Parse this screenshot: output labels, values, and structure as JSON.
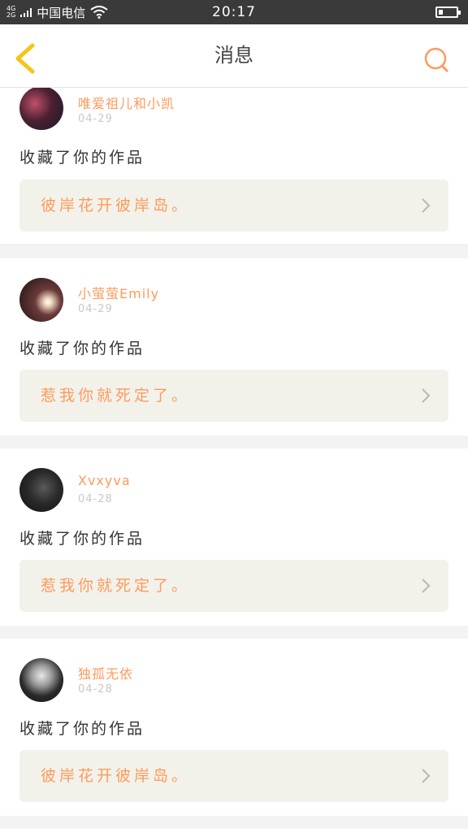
{
  "status_bar": {
    "network_top": "4G",
    "network_bottom": "2G",
    "carrier": "中国电信",
    "time": "20:17",
    "battery_level": 0.25
  },
  "nav": {
    "title": "消息",
    "back_icon": "chevron-left-icon",
    "search_icon": "search-icon"
  },
  "colors": {
    "accent": "#ff9a5c",
    "back_icon": "#f5c518",
    "work_bg": "#f2f2ea",
    "status_bar": "#3a3a3a"
  },
  "messages": [
    {
      "username": "唯爱祖儿和小凯",
      "date": "04-29",
      "action": "收藏了你的作品",
      "work_title": "彼岸花开彼岸岛。"
    },
    {
      "username": "小萤萤Emily",
      "date": "04-29",
      "action": "收藏了你的作品",
      "work_title": "惹我你就死定了。"
    },
    {
      "username": "Xvxyva",
      "date": "04-28",
      "action": "收藏了你的作品",
      "work_title": "惹我你就死定了。"
    },
    {
      "username": "独孤无依",
      "date": "04-28",
      "action": "收藏了你的作品",
      "work_title": "彼岸花开彼岸岛。"
    }
  ]
}
